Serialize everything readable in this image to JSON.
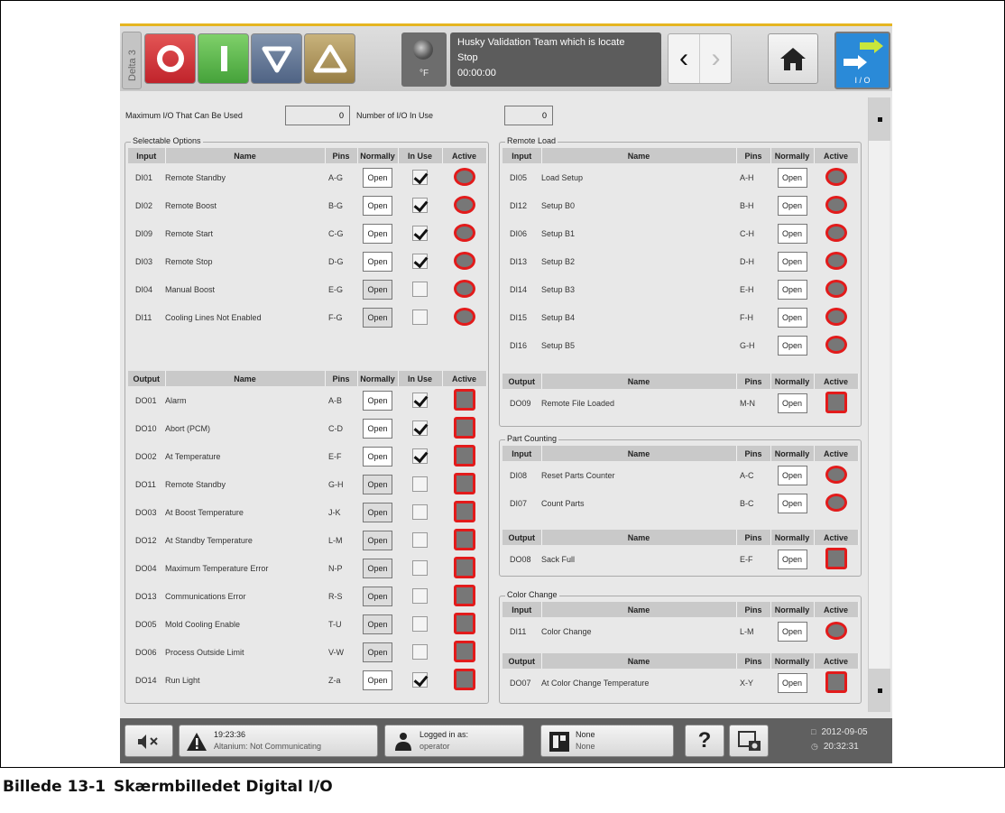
{
  "colors": {
    "accent": "#e5b521",
    "led_outline": "#e21b1b",
    "io_blue": "#2a8ad8"
  },
  "topbar": {
    "delta_tab": "Delta 3",
    "mode_buttons": [
      {
        "icon": "power-off-icon"
      },
      {
        "icon": "power-on-icon"
      },
      {
        "icon": "setback-down-icon"
      },
      {
        "icon": "boost-up-icon"
      }
    ],
    "temp_unit": "°F",
    "status_line1": "Husky Validation Team which is locate",
    "status_line2": "Stop",
    "status_line3": "00:00:00",
    "back_glyph": "‹",
    "forward_glyph": "›",
    "io_label": "I / O"
  },
  "header": {
    "max_io_label": "Maximum I/O That Can Be Used",
    "max_io_value": "0",
    "in_use_label": "Number of I/O In Use",
    "in_use_value": "0"
  },
  "selectable": {
    "title": "Selectable Options",
    "input_headers": [
      "Input",
      "Name",
      "Pins",
      "Normally",
      "In Use",
      "Active"
    ],
    "inputs": [
      {
        "io": "DI01",
        "name": "Remote Standby",
        "pins": "A-G",
        "normally": "Open",
        "in_use": true
      },
      {
        "io": "DI02",
        "name": "Remote Boost",
        "pins": "B-G",
        "normally": "Open",
        "in_use": true
      },
      {
        "io": "DI09",
        "name": "Remote Start",
        "pins": "C-G",
        "normally": "Open",
        "in_use": true
      },
      {
        "io": "DI03",
        "name": "Remote Stop",
        "pins": "D-G",
        "normally": "Open",
        "in_use": true
      },
      {
        "io": "DI04",
        "name": "Manual Boost",
        "pins": "E-G",
        "normally": "Open",
        "in_use": false
      },
      {
        "io": "DI11",
        "name": "Cooling Lines Not Enabled",
        "pins": "F-G",
        "normally": "Open",
        "in_use": false
      }
    ],
    "output_headers": [
      "Output",
      "Name",
      "Pins",
      "Normally",
      "In Use",
      "Active"
    ],
    "outputs": [
      {
        "io": "DO01",
        "name": "Alarm",
        "pins": "A-B",
        "normally": "Open",
        "in_use": true
      },
      {
        "io": "DO10",
        "name": "Abort (PCM)",
        "pins": "C-D",
        "normally": "Open",
        "in_use": true
      },
      {
        "io": "DO02",
        "name": "At Temperature",
        "pins": "E-F",
        "normally": "Open",
        "in_use": true
      },
      {
        "io": "DO11",
        "name": "Remote Standby",
        "pins": "G-H",
        "normally": "Open",
        "in_use": false
      },
      {
        "io": "DO03",
        "name": "At Boost Temperature",
        "pins": "J-K",
        "normally": "Open",
        "in_use": false
      },
      {
        "io": "DO12",
        "name": "At Standby Temperature",
        "pins": "L-M",
        "normally": "Open",
        "in_use": false
      },
      {
        "io": "DO04",
        "name": "Maximum Temperature Error",
        "pins": "N-P",
        "normally": "Open",
        "in_use": false
      },
      {
        "io": "DO13",
        "name": "Communications Error",
        "pins": "R-S",
        "normally": "Open",
        "in_use": false
      },
      {
        "io": "DO05",
        "name": "Mold Cooling Enable",
        "pins": "T-U",
        "normally": "Open",
        "in_use": false
      },
      {
        "io": "DO06",
        "name": "Process Outside Limit",
        "pins": "V-W",
        "normally": "Open",
        "in_use": false
      },
      {
        "io": "DO14",
        "name": "Run Light",
        "pins": "Z-a",
        "normally": "Open",
        "in_use": true
      }
    ]
  },
  "remote_load": {
    "title": "Remote Load",
    "input_headers": [
      "Input",
      "Name",
      "Pins",
      "Normally",
      "Active"
    ],
    "inputs": [
      {
        "io": "DI05",
        "name": "Load Setup",
        "pins": "A-H",
        "normally": "Open"
      },
      {
        "io": "DI12",
        "name": "Setup B0",
        "pins": "B-H",
        "normally": "Open"
      },
      {
        "io": "DI06",
        "name": "Setup B1",
        "pins": "C-H",
        "normally": "Open"
      },
      {
        "io": "DI13",
        "name": "Setup B2",
        "pins": "D-H",
        "normally": "Open"
      },
      {
        "io": "DI14",
        "name": "Setup B3",
        "pins": "E-H",
        "normally": "Open"
      },
      {
        "io": "DI15",
        "name": "Setup B4",
        "pins": "F-H",
        "normally": "Open"
      },
      {
        "io": "DI16",
        "name": "Setup B5",
        "pins": "G-H",
        "normally": "Open"
      }
    ],
    "output_headers": [
      "Output",
      "Name",
      "Pins",
      "Normally",
      "Active"
    ],
    "outputs": [
      {
        "io": "DO09",
        "name": "Remote File Loaded",
        "pins": "M-N",
        "normally": "Open"
      }
    ]
  },
  "part_counting": {
    "title": "Part Counting",
    "input_headers": [
      "Input",
      "Name",
      "Pins",
      "Normally",
      "Active"
    ],
    "inputs": [
      {
        "io": "DI08",
        "name": "Reset Parts Counter",
        "pins": "A-C",
        "normally": "Open"
      },
      {
        "io": "DI07",
        "name": "Count Parts",
        "pins": "B-C",
        "normally": "Open"
      }
    ],
    "output_headers": [
      "Output",
      "Name",
      "Pins",
      "Normally",
      "Active"
    ],
    "outputs": [
      {
        "io": "DO08",
        "name": "Sack Full",
        "pins": "E-F",
        "normally": "Open"
      }
    ]
  },
  "color_change": {
    "title": "Color Change",
    "input_headers": [
      "Input",
      "Name",
      "Pins",
      "Normally",
      "Active"
    ],
    "inputs": [
      {
        "io": "DI11",
        "name": "Color Change",
        "pins": "L-M",
        "normally": "Open"
      }
    ],
    "output_headers": [
      "Output",
      "Name",
      "Pins",
      "Normally",
      "Active"
    ],
    "outputs": [
      {
        "io": "DO07",
        "name": "At Color Change Temperature",
        "pins": "X-Y",
        "normally": "Open"
      }
    ]
  },
  "bottombar": {
    "alarm_time": "19:23:36",
    "alarm_text": "Altanium: Not Communicating",
    "login_label": "Logged in as:",
    "login_user": "operator",
    "mold_line1": "None",
    "mold_line2": "None",
    "help_glyph": "?",
    "date": "2012-09-05",
    "time": "20:32:31"
  },
  "caption": {
    "number": "Billede 13-1",
    "text": "Skærmbilledet Digital I/O"
  }
}
